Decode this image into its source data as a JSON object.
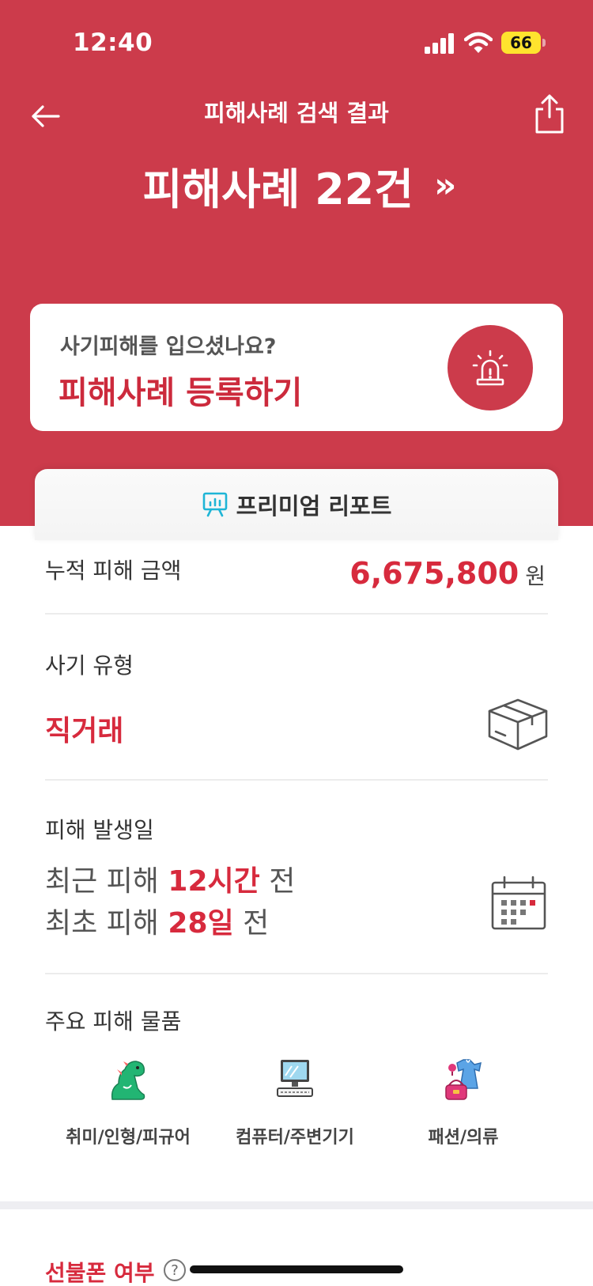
{
  "status_bar": {
    "time": "12:40",
    "battery": "66"
  },
  "header": {
    "title": "피해사례 검색 결과",
    "headline": "피해사례 22건",
    "headline_chevron": "»"
  },
  "register_card": {
    "subtitle": "사기피해를 입으셨나요?",
    "title": "피해사례 등록하기"
  },
  "premium_tab": {
    "label": "프리미엄 리포트"
  },
  "report": {
    "amount": {
      "label": "누적 피해 금액",
      "value": "6,675,800",
      "unit": "원"
    },
    "fraud_type": {
      "label": "사기 유형",
      "value": "직거래"
    },
    "dates": {
      "label": "피해 발생일",
      "recent_prefix": "최근 피해",
      "recent_value": "12시간",
      "recent_suffix": "전",
      "first_prefix": "최초 피해",
      "first_value": "28일",
      "first_suffix": "전"
    },
    "items": {
      "label": "주요 피해 물품",
      "list": [
        {
          "name": "취미/인형/피규어",
          "icon": "dinosaur-figure-icon"
        },
        {
          "name": "컴퓨터/주변기기",
          "icon": "computer-icon"
        },
        {
          "name": "패션/의류",
          "icon": "fashion-clothing-icon"
        }
      ]
    }
  },
  "prepaid": {
    "label": "선불폰 여부",
    "help": "?"
  },
  "colors": {
    "primary": "#cc3b4b",
    "accent_text": "#d72a3d"
  }
}
